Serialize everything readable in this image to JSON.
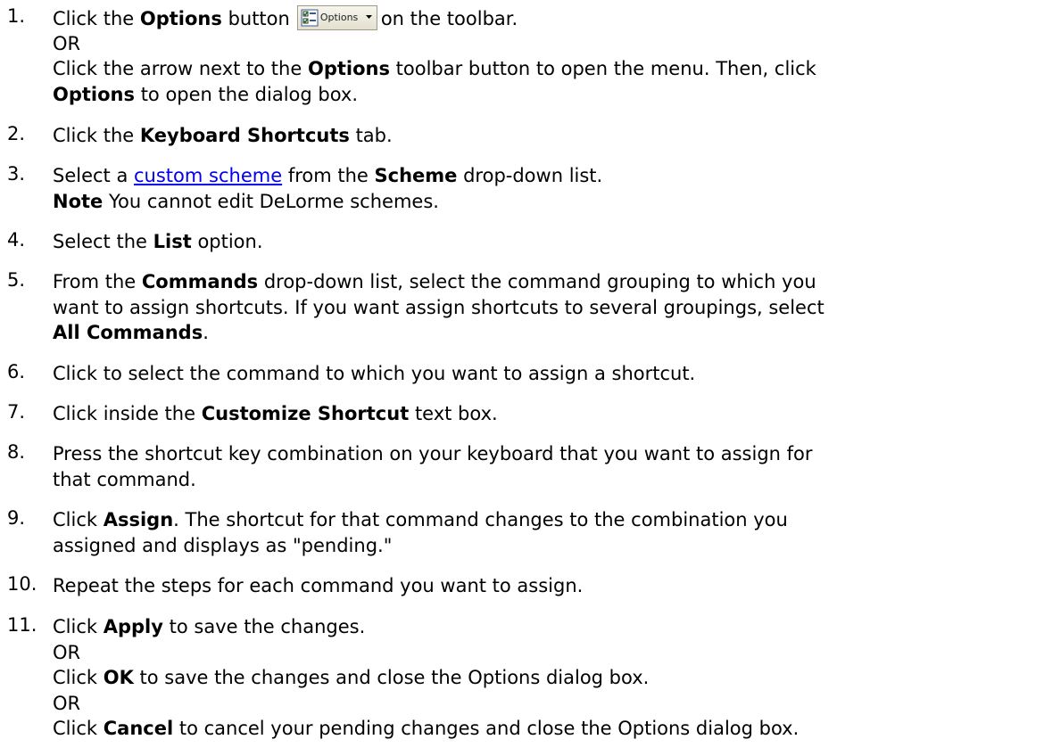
{
  "steps": [
    {
      "num": "1.",
      "click": "Click the",
      "options_bold": "Options",
      "button_word": "button",
      "toolbar_tail": "on the toolbar.",
      "or": "OR",
      "line3": "Click the arrow next to the",
      "line3_bold": "Options",
      "line3_tail": "toolbar button to open the menu. Then, click",
      "line4_bold": "Options",
      "line4_tail": "to open the dialog box.",
      "toolbar_button": {
        "label": "Options",
        "icon": "options-checklist-icon",
        "dropdown_icon": "dropdown-arrow-icon"
      }
    },
    {
      "num": "2.",
      "pre": "Click the",
      "bold": "Keyboard Shortcuts",
      "post": "tab."
    },
    {
      "num": "3.",
      "pre": "Select a",
      "link": "custom scheme",
      "mid": "from the",
      "bold": "Scheme",
      "post": "drop-down list.",
      "note_bold": "Note",
      "note_text": "You cannot edit DeLorme schemes."
    },
    {
      "num": "4.",
      "pre": "Select the",
      "bold": "List",
      "post": "option."
    },
    {
      "num": "5.",
      "pre": "From the",
      "bold": "Commands",
      "line1_tail": "drop-down list, select the command grouping to which you",
      "line2": "want to assign shortcuts. If you want assign shortcuts to several groupings, select",
      "line3_bold": "All Commands",
      "line3_tail": "."
    },
    {
      "num": "6.",
      "text": "Click to select the command to which you want to assign a shortcut."
    },
    {
      "num": "7.",
      "pre": "Click inside the",
      "bold": "Customize Shortcut",
      "post": "text box."
    },
    {
      "num": "8.",
      "line1": "Press the shortcut key combination on your keyboard that you want to assign for",
      "line2": "that command."
    },
    {
      "num": "9.",
      "pre": "Click",
      "bold": "Assign",
      "line1_tail": ". The shortcut for that command changes to the combination you",
      "line2": "assigned and displays as \"pending.\""
    },
    {
      "num": "10.",
      "text": "Repeat the steps for each command you want to assign."
    },
    {
      "num": "11.",
      "pre": "Click",
      "bold": "Apply",
      "post": "to save the changes.",
      "or1": "OR",
      "ok_pre": "Click",
      "ok_bold": "OK",
      "ok_post": "to save the changes and close the Options dialog box.",
      "or2": "OR",
      "cancel_pre": "Click",
      "cancel_bold": "Cancel",
      "cancel_post": "to cancel your pending changes and close the Options dialog box."
    }
  ],
  "colors": {
    "text": "#000000",
    "link": "#0000ee",
    "background": "#ffffff"
  }
}
